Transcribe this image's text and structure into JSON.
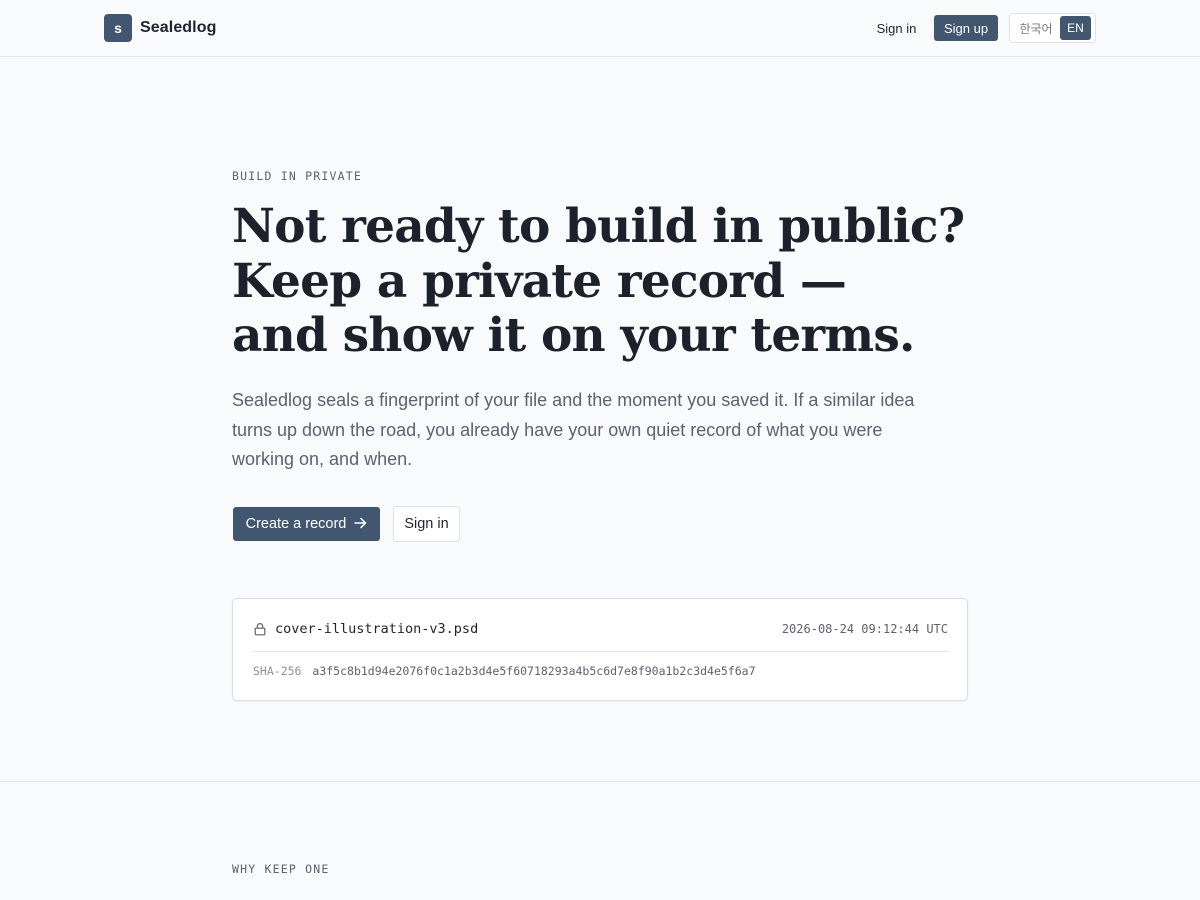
{
  "header": {
    "brand_mark": "s",
    "brand_name": "Sealedlog",
    "sign_in_label": "Sign in",
    "sign_up_label": "Sign up",
    "language_options": [
      "한국어",
      "EN"
    ],
    "selected_language": "EN"
  },
  "hero": {
    "eyebrow": "BUILD IN PRIVATE",
    "headline_lines": [
      "Not ready to build in public?",
      "Keep a private record —",
      "and show it on your terms."
    ],
    "lede": "Sealedlog seals a fingerprint of your file and the moment you saved it. If a similar idea turns up down the road, you already have your own quiet record of what you were working on, and when.",
    "primary_cta_label": "Create a record",
    "primary_cta_icon": "arrow-right-icon",
    "secondary_cta_label": "Sign in"
  },
  "record_example": {
    "icon": "lock-icon",
    "filename": "cover-illustration-v3.psd",
    "timestamp": "2026-08-24 09:12:44 UTC",
    "hash_label": "SHA-256",
    "hash_value": "a3f5c8b1d94e2076f0c1a2b3d4e5f60718293a4b5c6d7e8f90a1b2c3d4e5f6a7"
  },
  "why_section": {
    "eyebrow": "WHY KEEP ONE"
  },
  "colors": {
    "accent": "#42566f",
    "background": "#f8fafc",
    "text_primary": "#1d212c",
    "text_muted": "#5b6270",
    "border": "#dde2e8"
  }
}
